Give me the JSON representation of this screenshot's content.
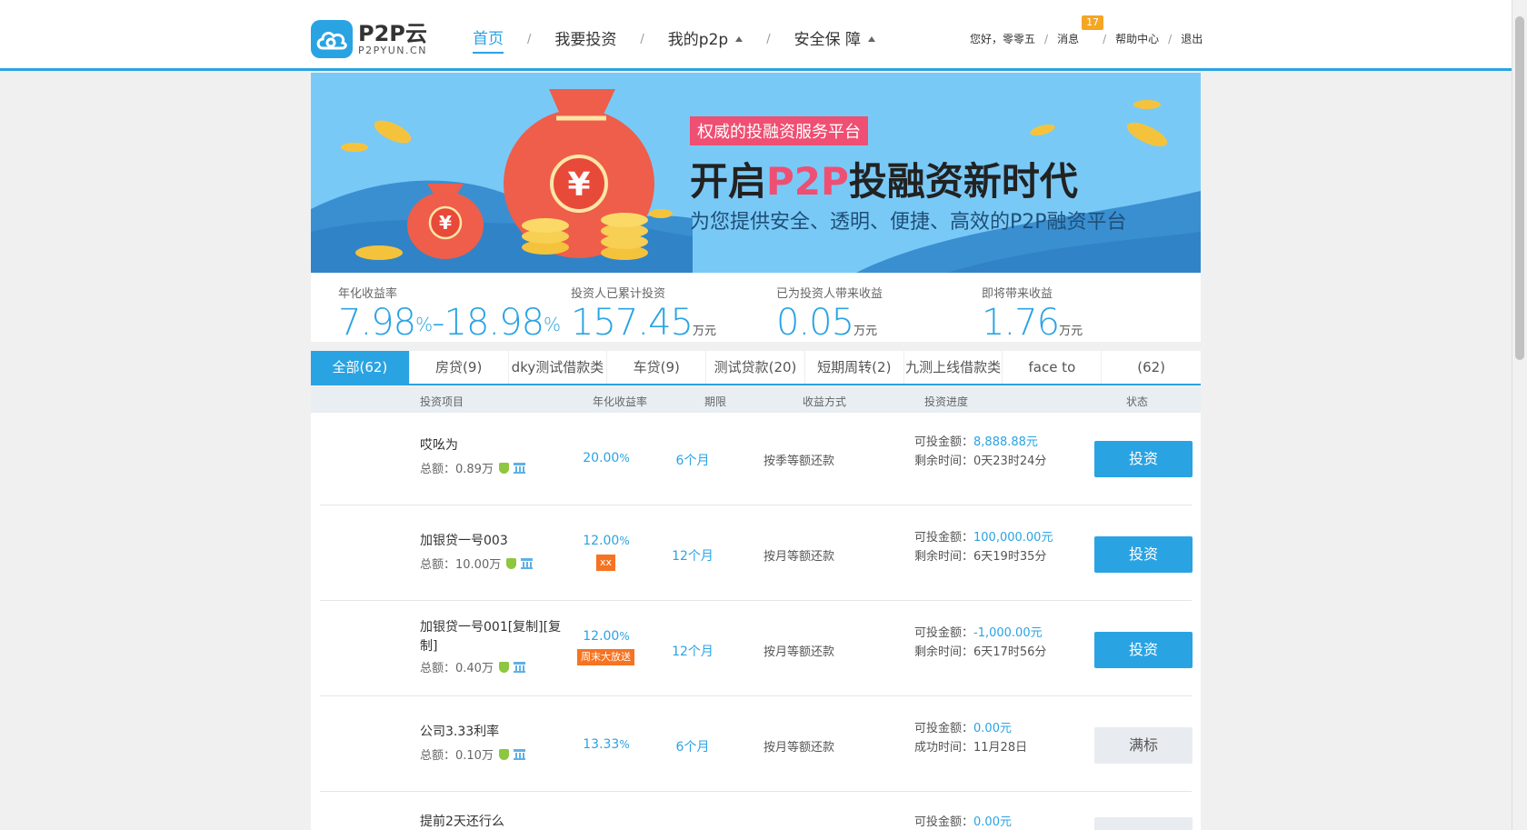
{
  "brand": {
    "name": "P2P云",
    "domain": "P2PYUN.CN"
  },
  "nav": [
    {
      "label": "首页",
      "active": true
    },
    {
      "label": "我要投资"
    },
    {
      "label": "我的p2p"
    },
    {
      "label": "安全保 障"
    }
  ],
  "nav_sep": "/",
  "top_links": {
    "greeting": "您好，零零五",
    "messages": "消息",
    "message_count": "17",
    "help": "帮助中心",
    "logout": "退出",
    "sep": "/"
  },
  "banner": {
    "tag": "权威的投融资服务平台",
    "title_pre": "开启",
    "title_hl": "P2P",
    "title_post": "投融资新时代",
    "subtitle": "为您提供安全、透明、便捷、高效的P2P融资平台"
  },
  "stats": [
    {
      "label": "年化收益率",
      "v1": "7.98",
      "s1": "%",
      "dash": "-",
      "v2": "18.98",
      "s2": "%"
    },
    {
      "label": "投资人已累计投资",
      "value": "157.45",
      "unit": "万元"
    },
    {
      "label": "已为投资人带来收益",
      "value": "0.05",
      "unit": "万元"
    },
    {
      "label": "即将带来收益",
      "value": "1.76",
      "unit": "万元"
    }
  ],
  "tabs": [
    "全部(62)",
    "房贷(9)",
    "dky测试借款类",
    "车贷(9)",
    "测试贷款(20)",
    "短期周转(2)",
    "九测上线借款类",
    "face to",
    "(62)"
  ],
  "columns": {
    "project": "投资项目",
    "rate": "年化收益率",
    "term": "期限",
    "method": "收益方式",
    "progress": "投资进度",
    "status": "状态"
  },
  "rows": [
    {
      "name": "哎吆为",
      "total": "总额：0.89万",
      "rate": "20.00",
      "rate_unit": "%",
      "badge": "",
      "term": "6个月",
      "method": "按季等额还款",
      "p1_label": "可投金额：",
      "p1_value": "8,888.88元",
      "p2_label": "剩余时间：",
      "p2_value": "0天23时24分",
      "action": "投资",
      "enabled": true
    },
    {
      "name": "加银贷一号003",
      "total": "总额：10.00万",
      "rate": "12.00",
      "rate_unit": "%",
      "badge": "xx",
      "term": "12个月",
      "method": "按月等额还款",
      "p1_label": "可投金额：",
      "p1_value": "100,000.00元",
      "p2_label": "剩余时间：",
      "p2_value": "6天19时35分",
      "action": "投资",
      "enabled": true
    },
    {
      "name": "加银贷一号001[复制][复制]",
      "total": "总额：0.40万",
      "rate": "12.00",
      "rate_unit": "%",
      "badge": "周末大放送",
      "term": "12个月",
      "method": "按月等额还款",
      "p1_label": "可投金额：",
      "p1_value": "-1,000.00元",
      "p2_label": "剩余时间：",
      "p2_value": "6天17时56分",
      "action": "投资",
      "enabled": true
    },
    {
      "name": "公司3.33利率",
      "total": "总额：0.10万",
      "rate": "13.33",
      "rate_unit": "%",
      "badge": "",
      "term": "6个月",
      "method": "按月等额还款",
      "p1_label": "可投金额：",
      "p1_value": "0.00元",
      "p2_label": "成功时间：",
      "p2_value": "11月28日",
      "action": "满标",
      "enabled": false
    },
    {
      "name": "提前2天还行么",
      "total": "",
      "rate": "",
      "rate_unit": "",
      "badge": "",
      "term": "",
      "method": "",
      "p1_label": "可投金额：",
      "p1_value": "0.00元",
      "p2_label": "",
      "p2_value": "",
      "action": "",
      "enabled": false
    }
  ],
  "colors": {
    "accent": "#2aa3e3",
    "banner_bg": "#79c9f7",
    "tag_pink": "#ef4f72",
    "badge_orange": "#f57321"
  }
}
